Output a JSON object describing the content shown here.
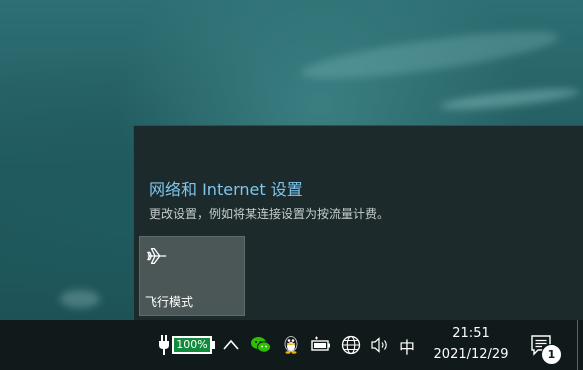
{
  "flyout": {
    "title": "网络和 Internet 设置",
    "subtitle": "更改设置，例如将某连接设置为按流量计费。",
    "quick_action": {
      "label": "飞行模式",
      "icon": "airplane-icon"
    }
  },
  "taskbar": {
    "battery": {
      "text": "100%",
      "level": 1.0,
      "icon": "plug-icon"
    },
    "tray_icons": [
      "chevron-up-icon",
      "wechat-icon",
      "qq-icon",
      "battery-status-icon",
      "network-globe-icon",
      "volume-icon"
    ],
    "ime": "中",
    "clock": {
      "time": "21:51",
      "date": "2021/12/29"
    },
    "notifications": {
      "icon": "notification-icon",
      "count": "1"
    }
  },
  "colors": {
    "flyout_bg": "#1d2a2b",
    "title_accent": "#7fc5ec",
    "tile_bg": "#4b5757",
    "taskbar_bg": "#101a1b",
    "battery_fill": "#118a3c"
  }
}
